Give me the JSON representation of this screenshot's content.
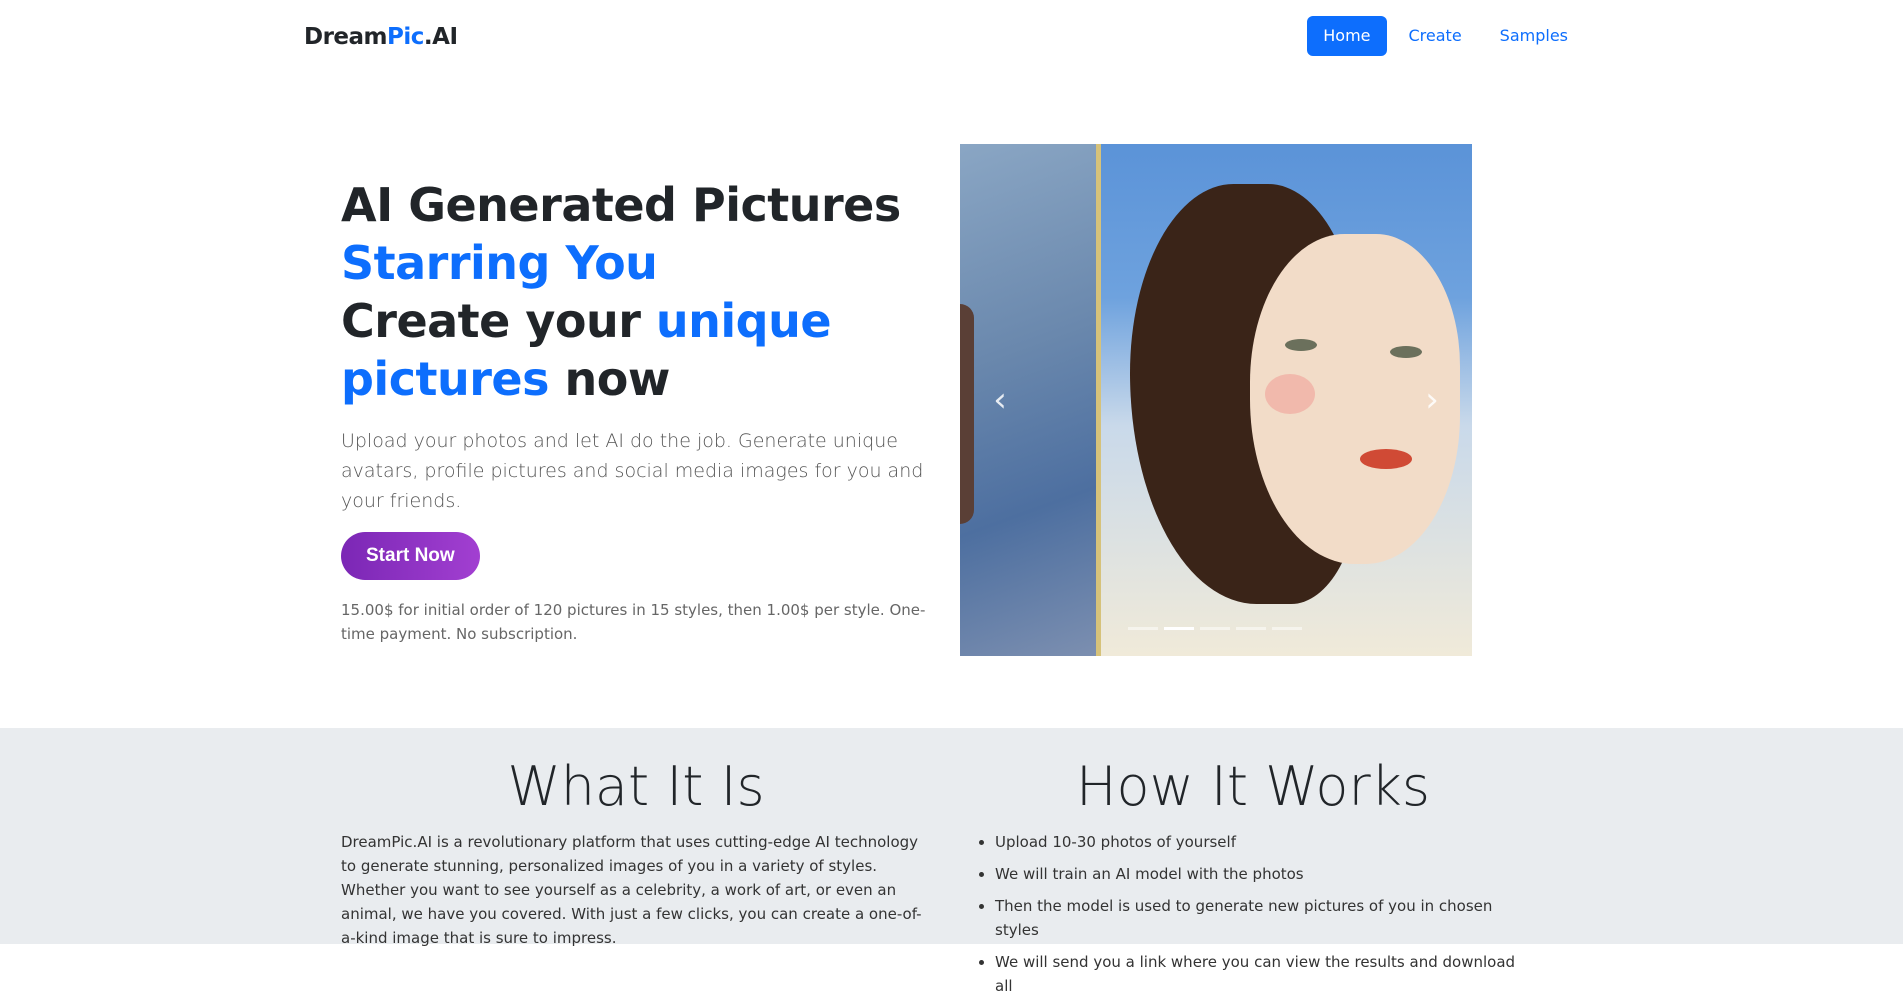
{
  "brand": {
    "part1": "Dream",
    "part2": "Pic",
    "part3": ".AI"
  },
  "nav": {
    "home": "Home",
    "create": "Create",
    "samples": "Samples"
  },
  "hero": {
    "line1": "AI Generated Pictures",
    "line2": "Starring You",
    "line3a": "Create your ",
    "line3b": "unique",
    "line4a": "pictures",
    "line4b": " now",
    "lead": "Upload your photos and let AI do the job. Generate unique avatars, profile pictures and social media images for you and your friends.",
    "cta": "Start Now",
    "pricing": "15.00$ for initial order of 120 pictures in 15 styles, then 1.00$ per style. One-time payment. No subscription."
  },
  "carousel": {
    "prev_icon": "chevron-left-icon",
    "next_icon": "chevron-right-icon",
    "prev_glyph": "‹",
    "next_glyph": "›",
    "indicator_count": 5,
    "active_index": 1
  },
  "what": {
    "title": "What It Is",
    "body": "DreamPic.AI is a revolutionary platform that uses cutting-edge AI technology to generate stunning, personalized images of you in a variety of styles. Whether you want to see yourself as a celebrity, a work of art, or even an animal, we have you covered. With just a few clicks, you can create a one-of-a-kind image that is sure to impress."
  },
  "how": {
    "title": "How It Works",
    "steps": [
      "Upload 10-30 photos of yourself",
      "We will train an AI model with the photos",
      "Then the model is used to generate new pictures of you in chosen styles",
      "We will send you a link where you can view the results and download all"
    ]
  },
  "colors": {
    "primary": "#0d6efd",
    "cta_start": "#7b27b5",
    "cta_end": "#a23fd1",
    "band": "#e9ecef"
  }
}
